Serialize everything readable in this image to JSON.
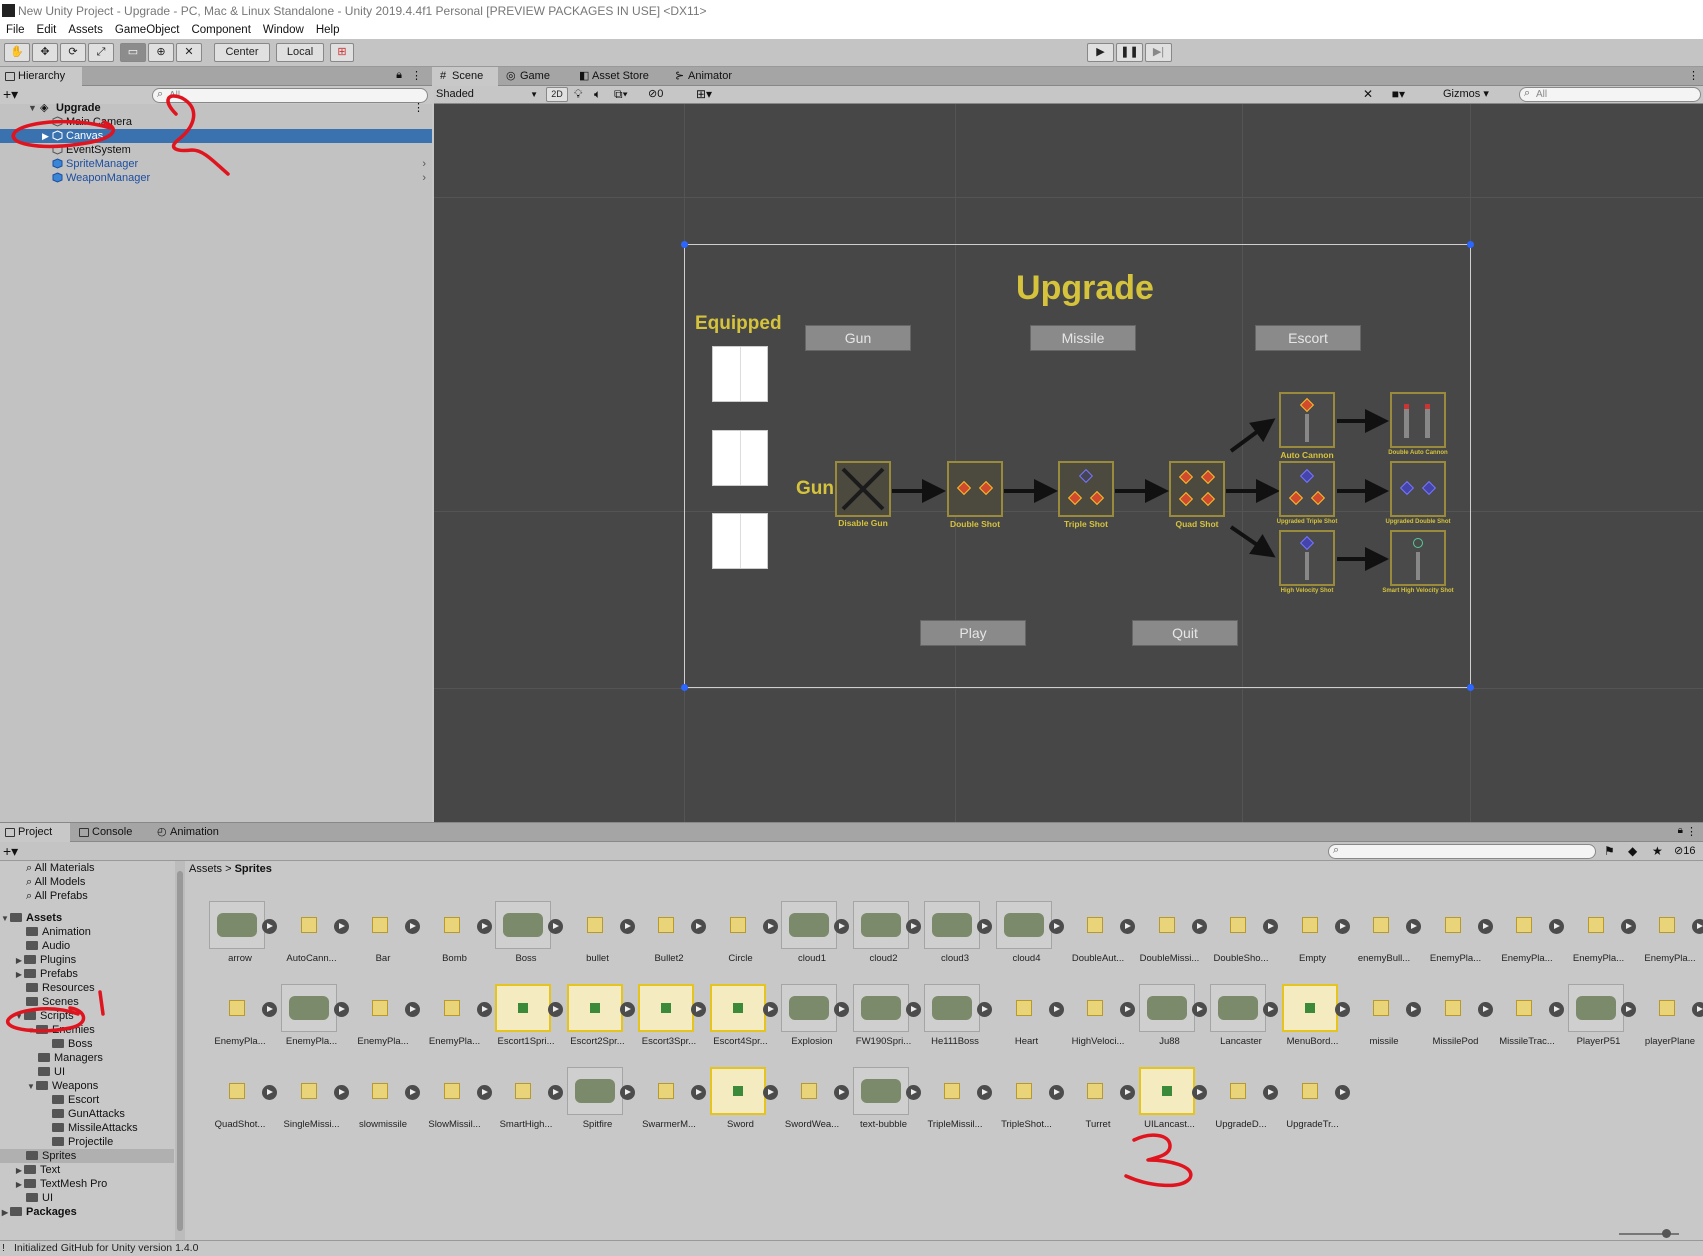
{
  "window": {
    "title": "New Unity Project - Upgrade - PC, Mac & Linux Standalone - Unity 2019.4.4f1 Personal [PREVIEW PACKAGES IN USE] <DX11>"
  },
  "menu": [
    "File",
    "Edit",
    "Assets",
    "GameObject",
    "Component",
    "Window",
    "Help"
  ],
  "toolbar": {
    "center_label": "Center",
    "local_label": "Local"
  },
  "hierarchy": {
    "tab": "Hierarchy",
    "search_placeholder": "All",
    "scene_name": "Upgrade",
    "items": [
      "Main Camera",
      "Canvas",
      "EventSystem",
      "SpriteManager",
      "WeaponManager"
    ]
  },
  "scene_tabs": [
    "Scene",
    "Game",
    "Asset Store",
    "Animator"
  ],
  "scene_toolbar": {
    "draw_mode": "Shaded",
    "mode_2d": "2D",
    "hidden_count": "0",
    "gizmos": "Gizmos",
    "search_placeholder": "All"
  },
  "ui_canvas": {
    "title": "Upgrade",
    "equipped": "Equipped",
    "categories": [
      "Gun",
      "Missile",
      "Escort"
    ],
    "row_label": "Gun",
    "upgrades": {
      "disable_gun": "Disable Gun",
      "double_shot": "Double Shot",
      "triple_shot": "Triple Shot",
      "quad_shot": "Quad Shot",
      "auto_cannon": "Auto Cannon",
      "double_auto_cannon": "Double Auto Cannon",
      "upgraded_triple_shot": "Upgraded Triple Shot",
      "upgraded_double_shot": "Upgraded Double Shot",
      "high_velocity_shot": "High Velocity Shot",
      "smart_high_velocity_shot": "Smart High Velocity Shot"
    },
    "play": "Play",
    "quit": "Quit"
  },
  "project": {
    "tabs": [
      "Project",
      "Console",
      "Animation"
    ],
    "hidden_count": "16",
    "breadcrumb": [
      "Assets",
      "Sprites"
    ],
    "favorites": [
      "All Materials",
      "All Models",
      "All Prefabs"
    ],
    "tree": [
      {
        "label": "Assets",
        "bold": true
      },
      {
        "label": "Animation"
      },
      {
        "label": "Audio"
      },
      {
        "label": "Plugins"
      },
      {
        "label": "Prefabs"
      },
      {
        "label": "Resources"
      },
      {
        "label": "Scenes"
      },
      {
        "label": "Scripts"
      },
      {
        "label": "Enemies"
      },
      {
        "label": "Boss"
      },
      {
        "label": "Managers"
      },
      {
        "label": "UI"
      },
      {
        "label": "Weapons"
      },
      {
        "label": "Escort"
      },
      {
        "label": "GunAttacks"
      },
      {
        "label": "MissileAttacks"
      },
      {
        "label": "Projectile"
      },
      {
        "label": "Sprites"
      },
      {
        "label": "Text"
      },
      {
        "label": "TextMesh Pro"
      },
      {
        "label": "UI"
      },
      {
        "label": "Packages",
        "bold": true
      }
    ],
    "assets_row1": [
      "arrow",
      "AutoCann...",
      "Bar",
      "Bomb",
      "Boss",
      "bullet",
      "Bullet2",
      "Circle",
      "cloud1",
      "cloud2",
      "cloud3",
      "cloud4",
      "DoubleAut...",
      "DoubleMissi...",
      "DoubleSho...",
      "Empty",
      "enemyBull...",
      "EnemyPla...",
      "EnemyPla...",
      "EnemyPla...",
      "EnemyPla..."
    ],
    "assets_row2": [
      "EnemyPla...",
      "EnemyPla...",
      "EnemyPla...",
      "EnemyPla...",
      "Escort1Spri...",
      "Escort2Spr...",
      "Escort3Spr...",
      "Escort4Spr...",
      "Explosion",
      "FW190Spri...",
      "He111Boss",
      "Heart",
      "HighVeloci...",
      "Ju88",
      "Lancaster",
      "MenuBord...",
      "missile",
      "MissilePod",
      "MissileTrac...",
      "PlayerP51",
      "playerPlane"
    ],
    "assets_row3": [
      "QuadShot...",
      "SingleMissi...",
      "slowmissile",
      "SlowMissil...",
      "SmartHigh...",
      "Spitfire",
      "SwarmerM...",
      "Sword",
      "SwordWea...",
      "text-bubble",
      "TripleMissil...",
      "TripleShot...",
      "Turret",
      "UILancast...",
      "UpgradeD...",
      "UpgradeTr..."
    ]
  },
  "status": "Initialized GitHub for Unity version 1.4.0",
  "colors": {
    "selection": "#3a72b0",
    "ui_yellow": "#d6c33c",
    "scene_bg": "#474747",
    "annotation_red": "#e0141e"
  }
}
